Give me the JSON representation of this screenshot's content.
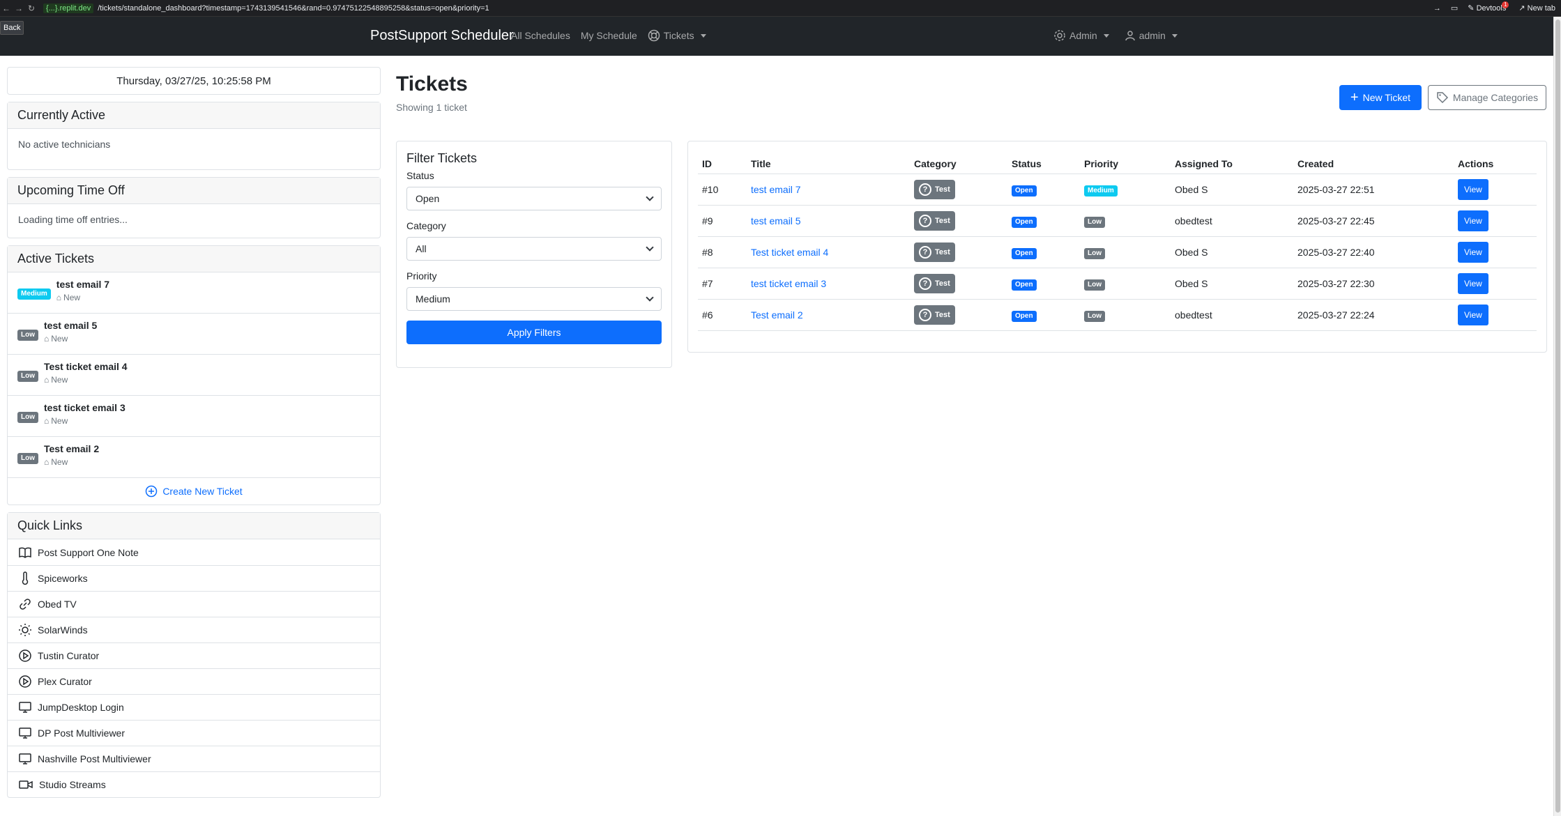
{
  "browser": {
    "host": "{...}.replit.dev",
    "path": "/tickets/standalone_dashboard?timestamp=1743139541546&rand=0.97475122548895258&status=open&priority=1",
    "devtools_label": "Devtools",
    "devtools_count": "1",
    "newtab_label": "New tab",
    "back_label": "Back"
  },
  "navbar": {
    "brand": "PostSupport Scheduler",
    "links": [
      "All Schedules",
      "My Schedule",
      "Tickets"
    ],
    "admin_menu": "Admin",
    "user_menu": "admin"
  },
  "sidebar": {
    "datetime": "Thursday, 03/27/25, 10:25:58 PM",
    "currently_active": {
      "title": "Currently Active",
      "body": "No active technicians"
    },
    "time_off": {
      "title": "Upcoming Time Off",
      "body": "Loading time off entries..."
    },
    "active_tickets": {
      "title": "Active Tickets",
      "items": [
        {
          "priority": "Medium",
          "title": "test email 7",
          "status": "New"
        },
        {
          "priority": "Low",
          "title": "test email 5",
          "status": "New"
        },
        {
          "priority": "Low",
          "title": "Test ticket email 4",
          "status": "New"
        },
        {
          "priority": "Low",
          "title": "test ticket email 3",
          "status": "New"
        },
        {
          "priority": "Low",
          "title": "Test email 2",
          "status": "New"
        }
      ],
      "create_label": "Create New Ticket"
    },
    "quick_links": {
      "title": "Quick Links",
      "items": [
        {
          "label": "Post Support One Note",
          "icon": "book-icon"
        },
        {
          "label": "Spiceworks",
          "icon": "thermometer-icon"
        },
        {
          "label": "Obed TV",
          "icon": "link-icon"
        },
        {
          "label": "SolarWinds",
          "icon": "sun-icon"
        },
        {
          "label": "Tustin Curator",
          "icon": "play-circle-icon"
        },
        {
          "label": "Plex Curator",
          "icon": "play-circle-icon"
        },
        {
          "label": "JumpDesktop Login",
          "icon": "monitor-icon"
        },
        {
          "label": "DP Post Multiviewer",
          "icon": "monitor-icon"
        },
        {
          "label": "Nashville Post Multiviewer",
          "icon": "monitor-icon"
        },
        {
          "label": "Studio Streams",
          "icon": "video-icon"
        }
      ]
    }
  },
  "main": {
    "title": "Tickets",
    "subtitle": "Showing 1 ticket",
    "new_ticket_label": "New Ticket",
    "manage_categories_label": "Manage Categories",
    "filters": {
      "title": "Filter Tickets",
      "status_label": "Status",
      "status_value": "Open",
      "category_label": "Category",
      "category_value": "All",
      "priority_label": "Priority",
      "priority_value": "Medium",
      "apply_label": "Apply Filters"
    },
    "table": {
      "headers": [
        "ID",
        "Title",
        "Category",
        "Status",
        "Priority",
        "Assigned To",
        "Created",
        "Actions"
      ],
      "rows": [
        {
          "id": "#10",
          "title": "test email 7",
          "category": "Test",
          "status": "Open",
          "priority": "Medium",
          "assigned": "Obed S",
          "created": "2025-03-27 22:51",
          "action": "View"
        },
        {
          "id": "#9",
          "title": "test email 5",
          "category": "Test",
          "status": "Open",
          "priority": "Low",
          "assigned": "obedtest",
          "created": "2025-03-27 22:45",
          "action": "View"
        },
        {
          "id": "#8",
          "title": "Test ticket email 4",
          "category": "Test",
          "status": "Open",
          "priority": "Low",
          "assigned": "Obed S",
          "created": "2025-03-27 22:40",
          "action": "View"
        },
        {
          "id": "#7",
          "title": "test ticket email 3",
          "category": "Test",
          "status": "Open",
          "priority": "Low",
          "assigned": "Obed S",
          "created": "2025-03-27 22:30",
          "action": "View"
        },
        {
          "id": "#6",
          "title": "Test email 2",
          "category": "Test",
          "status": "Open",
          "priority": "Low",
          "assigned": "obedtest",
          "created": "2025-03-27 22:24",
          "action": "View"
        }
      ]
    }
  },
  "colors": {
    "primary": "#0d6efd",
    "info": "#0dcaf0",
    "secondary": "#6c757d",
    "navbar": "#212529"
  }
}
